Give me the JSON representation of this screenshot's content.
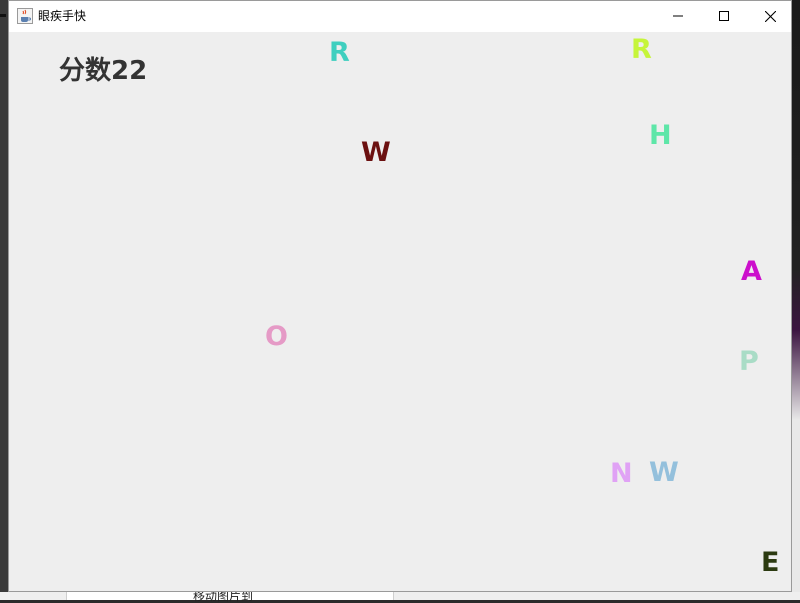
{
  "window": {
    "title": "眼疾手快"
  },
  "desktop": {
    "bottom_text": "移动图片到"
  },
  "game": {
    "score_text": "分数22",
    "letters": [
      {
        "char": "R",
        "color": "#3fcfbf"
      },
      {
        "char": "R",
        "color": "#c6f53a"
      },
      {
        "char": "H",
        "color": "#5ee6a8"
      },
      {
        "char": "W",
        "color": "#6b1010"
      },
      {
        "char": "A",
        "color": "#cc0fcc"
      },
      {
        "char": "O",
        "color": "#e59ac6"
      },
      {
        "char": "P",
        "color": "#a9dcc6"
      },
      {
        "char": "N",
        "color": "#e0a2f5"
      },
      {
        "char": "W",
        "color": "#94c0dc"
      },
      {
        "char": "E",
        "color": "#2b3a10"
      }
    ]
  },
  "icons": {
    "app": "java-coffee-icon",
    "minimize": "minimize-icon",
    "maximize": "maximize-icon",
    "close": "close-icon"
  }
}
